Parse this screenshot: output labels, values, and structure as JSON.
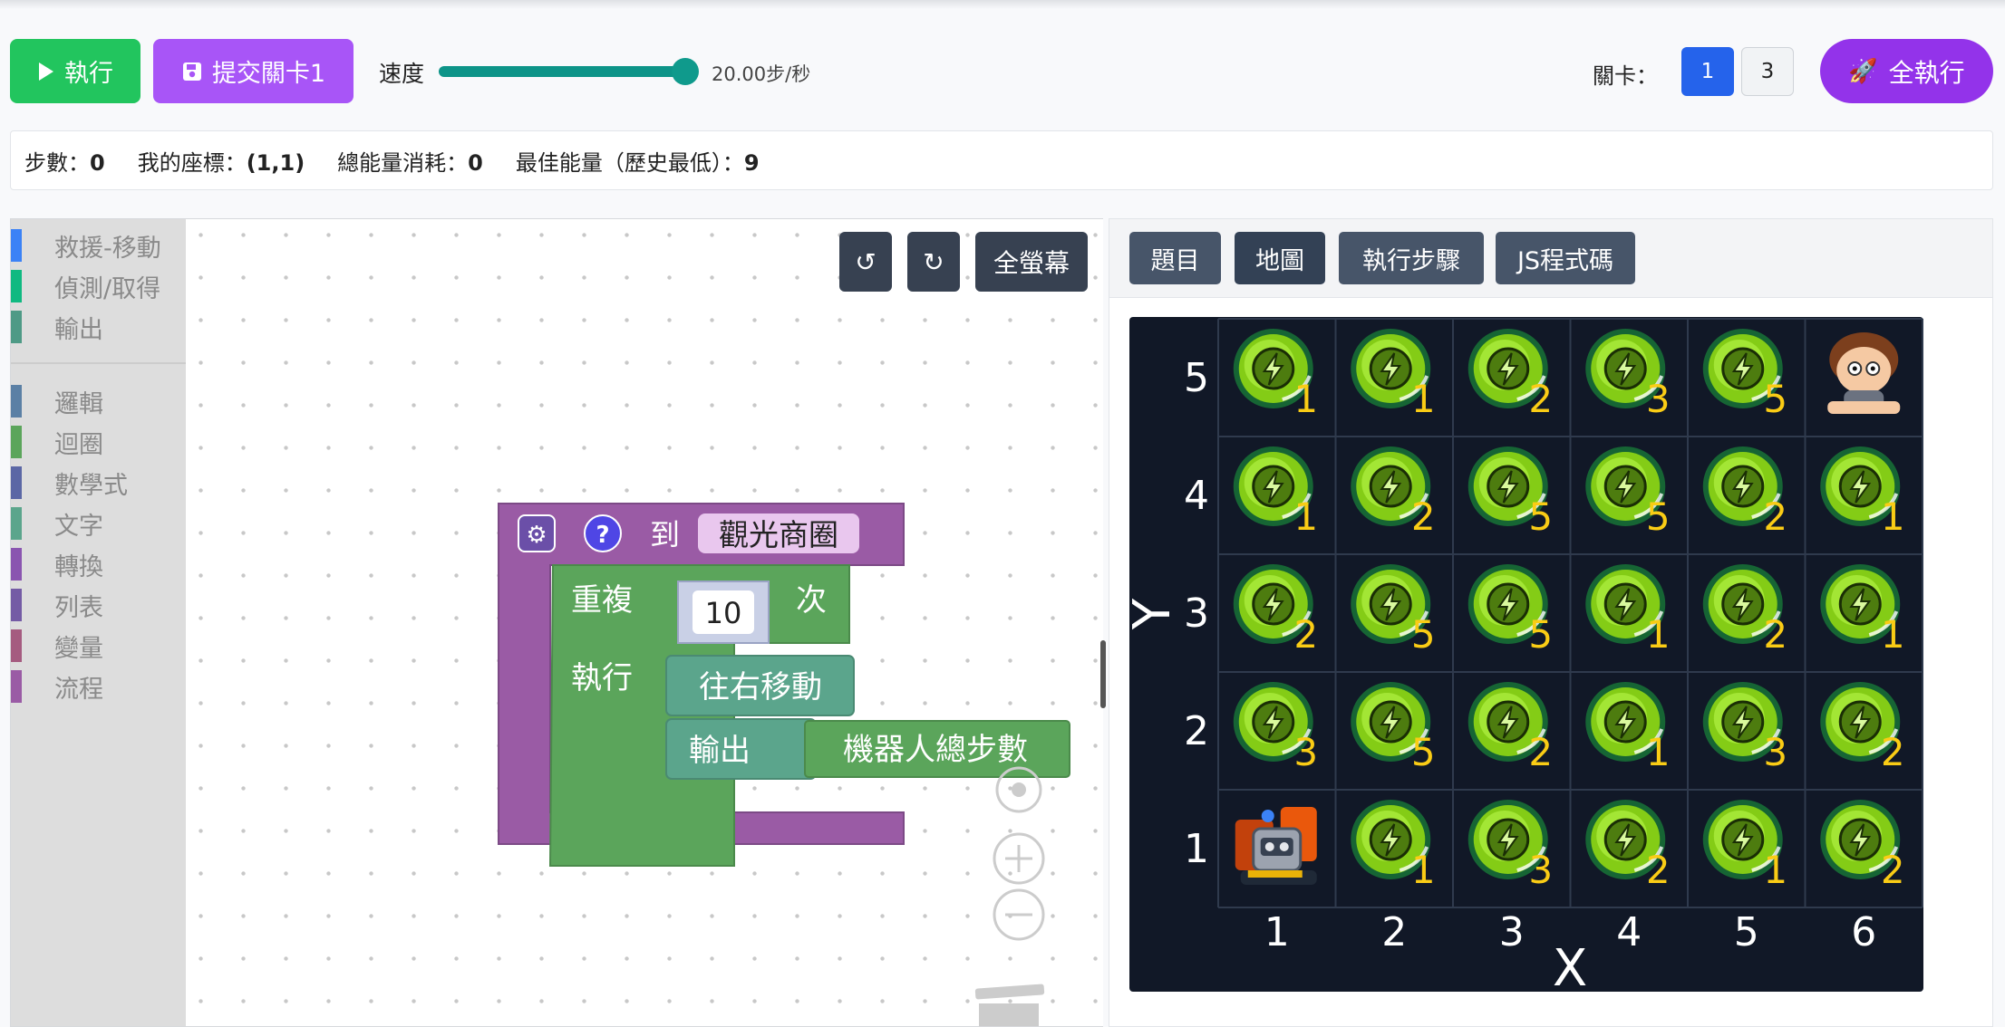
{
  "toolbar": {
    "run_label": "執行",
    "submit_label": "提交關卡1",
    "speed_label": "速度",
    "speed_value": "20.00步/秒",
    "speed_fraction": 0.95,
    "level_label": "關卡：",
    "levels": [
      "1",
      "3"
    ],
    "active_level": "1",
    "run_all_label": "全執行"
  },
  "stats": {
    "steps_label": "步數：",
    "steps": "0",
    "coord_label": "我的座標：",
    "coord": "(1,1)",
    "energy_label": "總能量消耗：",
    "energy": "0",
    "best_label": "最佳能量（歷史最低）：",
    "best": "9"
  },
  "toolbox": {
    "categories": [
      {
        "label": "救援-移動",
        "color": "#3b82f6"
      },
      {
        "label": "偵測/取得",
        "color": "#10b981"
      },
      {
        "label": "輸出",
        "color": "#4e9a86"
      },
      {
        "label": "邏輯",
        "color": "#5b80a5"
      },
      {
        "label": "迴圈",
        "color": "#5ba55b"
      },
      {
        "label": "數學式",
        "color": "#5b67a5"
      },
      {
        "label": "文字",
        "color": "#5ba58c"
      },
      {
        "label": "轉換",
        "color": "#8a55b0"
      },
      {
        "label": "列表",
        "color": "#745ba5"
      },
      {
        "label": "變量",
        "color": "#a55b80"
      },
      {
        "label": "流程",
        "color": "#9a5ba5"
      }
    ]
  },
  "workspace": {
    "undo_icon": "↺",
    "redo_icon": "↻",
    "fullscreen_label": "全螢幕",
    "blocks": {
      "proc_to": "到",
      "proc_name": "觀光商圈",
      "repeat": "重複",
      "repeat_count": "10",
      "times": "次",
      "do": "執行",
      "move_right": "往右移動",
      "output": "輸出",
      "total_steps": "機器人總步數"
    }
  },
  "panel": {
    "tabs": [
      "題目",
      "地圖",
      "執行步驟",
      "JS程式碼"
    ],
    "active_tab": "地圖"
  },
  "map": {
    "x_axis": "X",
    "y_axis": "Y",
    "x_ticks": [
      "1",
      "2",
      "3",
      "4",
      "5",
      "6"
    ],
    "y_ticks": [
      "5",
      "4",
      "3",
      "2",
      "1"
    ],
    "cells": [
      [
        "1",
        "1",
        "2",
        "3",
        "5",
        "person"
      ],
      [
        "1",
        "2",
        "5",
        "5",
        "2",
        "1"
      ],
      [
        "2",
        "5",
        "5",
        "1",
        "2",
        "1"
      ],
      [
        "3",
        "5",
        "2",
        "1",
        "3",
        "2"
      ],
      [
        "robot",
        "1",
        "3",
        "2",
        "1",
        "2"
      ]
    ]
  }
}
